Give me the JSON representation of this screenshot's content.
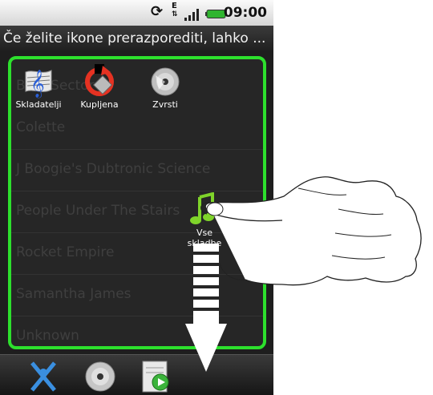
{
  "status": {
    "time": "09:00",
    "network_label": "E"
  },
  "hint": {
    "text": "Če želite ikone prerazporediti, lahko ..."
  },
  "tabs": [
    {
      "label": "Skladatelji",
      "icon": "composer-icon"
    },
    {
      "label": "Kupljena",
      "icon": "purchased-icon"
    },
    {
      "label": "Zvrsti",
      "icon": "genre-cd-icon"
    }
  ],
  "dragging": {
    "label_line1": "Vse",
    "label_line2": "skladbe",
    "icon": "music-note-icon"
  },
  "artists": [
    "Blue Sector",
    "Colette",
    "J Boogie's Dubtronic Science",
    "People Under The Stairs",
    "Rocket Empire",
    "Samantha James",
    "Unknown"
  ],
  "bottom_tabs": [
    {
      "icon": "artist-icon"
    },
    {
      "icon": "album-cd-icon"
    },
    {
      "icon": "playlist-icon"
    }
  ],
  "colors": {
    "highlight": "#2de02d",
    "arrow": "#ffffff"
  }
}
